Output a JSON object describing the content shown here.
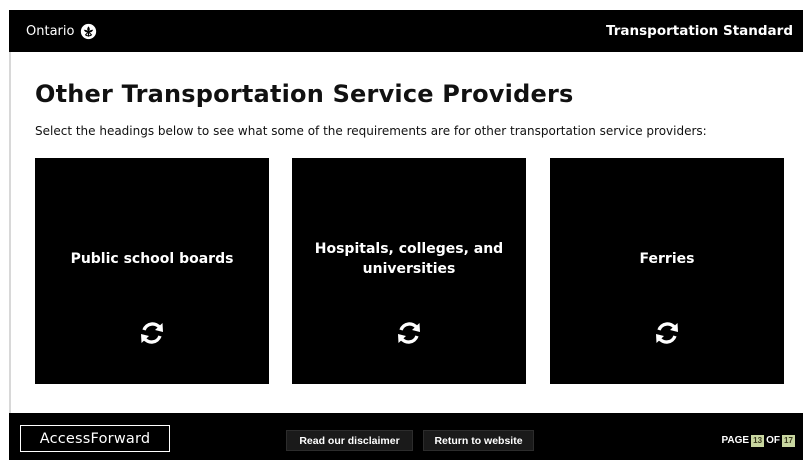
{
  "header": {
    "brand_text": "Ontario",
    "brand_icon": "trillium-icon",
    "module_title": "Transportation Standard"
  },
  "main": {
    "title": "Other Transportation Service Providers",
    "intro": "Select the headings below to see what some of the requirements are for other transportation service providers:",
    "cards": [
      {
        "label": "Public school boards",
        "icon": "flip-refresh-icon"
      },
      {
        "label": "Hospitals, colleges, and universities",
        "icon": "flip-refresh-icon"
      },
      {
        "label": "Ferries",
        "icon": "flip-refresh-icon"
      }
    ]
  },
  "footer": {
    "logo_text": "AccessForward",
    "disclaimer_label": "Read our disclaimer",
    "website_label": "Return to website",
    "page_label": "PAGE",
    "current_page": "13",
    "of_label": "OF",
    "total_pages": "17"
  },
  "colors": {
    "bar_background": "#000000",
    "card_background": "#000000",
    "page_background": "#ffffff",
    "page_number_highlight": "#c8d6a0"
  }
}
